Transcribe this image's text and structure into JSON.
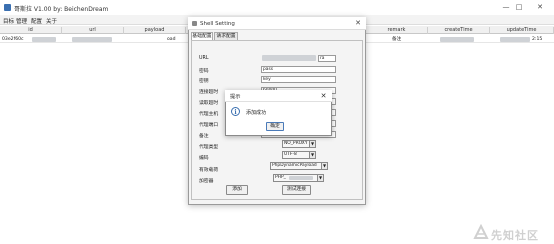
{
  "window": {
    "title": "哥斯拉 V1.00   by: BeichenDream",
    "minimize_icon": "—",
    "maximize_icon": "□",
    "close_icon": "✕"
  },
  "menu": [
    "目标",
    "管理",
    "配置",
    "关于"
  ],
  "table": {
    "columns": [
      "id",
      "url",
      "payload",
      "remark",
      "createTime",
      "updateTime"
    ],
    "row": {
      "id": "03e2f60c",
      "payload": "oad",
      "remark": "备注",
      "updateTime": "2:15"
    }
  },
  "shell_setting": {
    "title": "Shell Setting",
    "close_icon": "✕",
    "tabs": [
      "基础配置",
      "请求配置"
    ],
    "labels": {
      "url": "URL",
      "password": "密码",
      "secret": "密钥",
      "connect_timeout": "连接超时",
      "read_timeout": "读取超时",
      "proxy_host": "代理主机",
      "proxy_port": "代理端口",
      "remark": "备注",
      "proxy_type": "代理类型",
      "encoding": "编码",
      "payload": "有效载荷",
      "cryption": "加密器"
    },
    "values": {
      "url_suffix": "ra",
      "password": "pass",
      "secret": "key",
      "connect_timeout": "60000",
      "proxy_type": "NO_PROXY",
      "encoding": "UTF-8",
      "payload": "PhpDynamicPayload",
      "cryption": "PHP_"
    },
    "buttons": {
      "add": "添加",
      "test": "测试连接"
    },
    "dropdown_arrow": "▼"
  },
  "info_dialog": {
    "title": "提示",
    "close_icon": "✕",
    "icon_glyph": "i",
    "message": "添加成功",
    "ok": "确定"
  },
  "watermark": {
    "text": "先知社区"
  }
}
